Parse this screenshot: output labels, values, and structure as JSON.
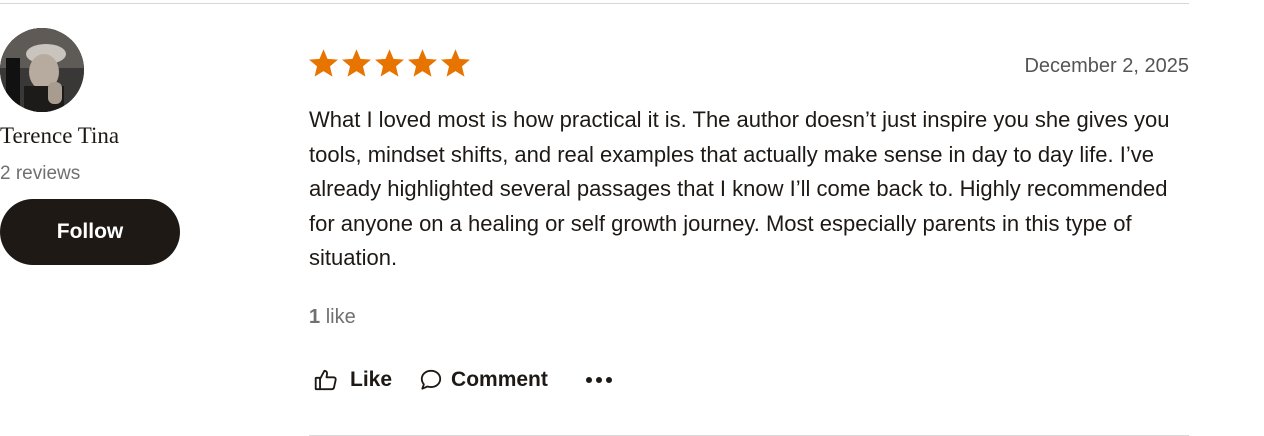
{
  "reviewer": {
    "name": "Terence Tina",
    "reviews_count": "2 reviews",
    "follow_label": "Follow"
  },
  "review": {
    "rating": 5,
    "max_rating": 5,
    "star_color": "#e87400",
    "date": "December 2, 2025",
    "text": "What I loved most is how practical it is. The author doesn’t just inspire you she gives you tools, mindset shifts, and real examples that actually make sense in day to day life. I’ve already highlighted several passages that I know I’ll come back to. Highly recommended for anyone on a healing or self growth journey. Most especially parents in this type of situation.",
    "likes_number": "1",
    "likes_word": "like"
  },
  "actions": {
    "like_label": "Like",
    "comment_label": "Comment",
    "like_icon": "thumbs-up-icon",
    "comment_icon": "comment-bubble-icon",
    "more_icon": "more-horizontal-icon"
  },
  "colors": {
    "text_primary": "#1e1915",
    "text_secondary": "#707070",
    "button_bg": "#1e1915",
    "divider": "#d8d8d8"
  }
}
